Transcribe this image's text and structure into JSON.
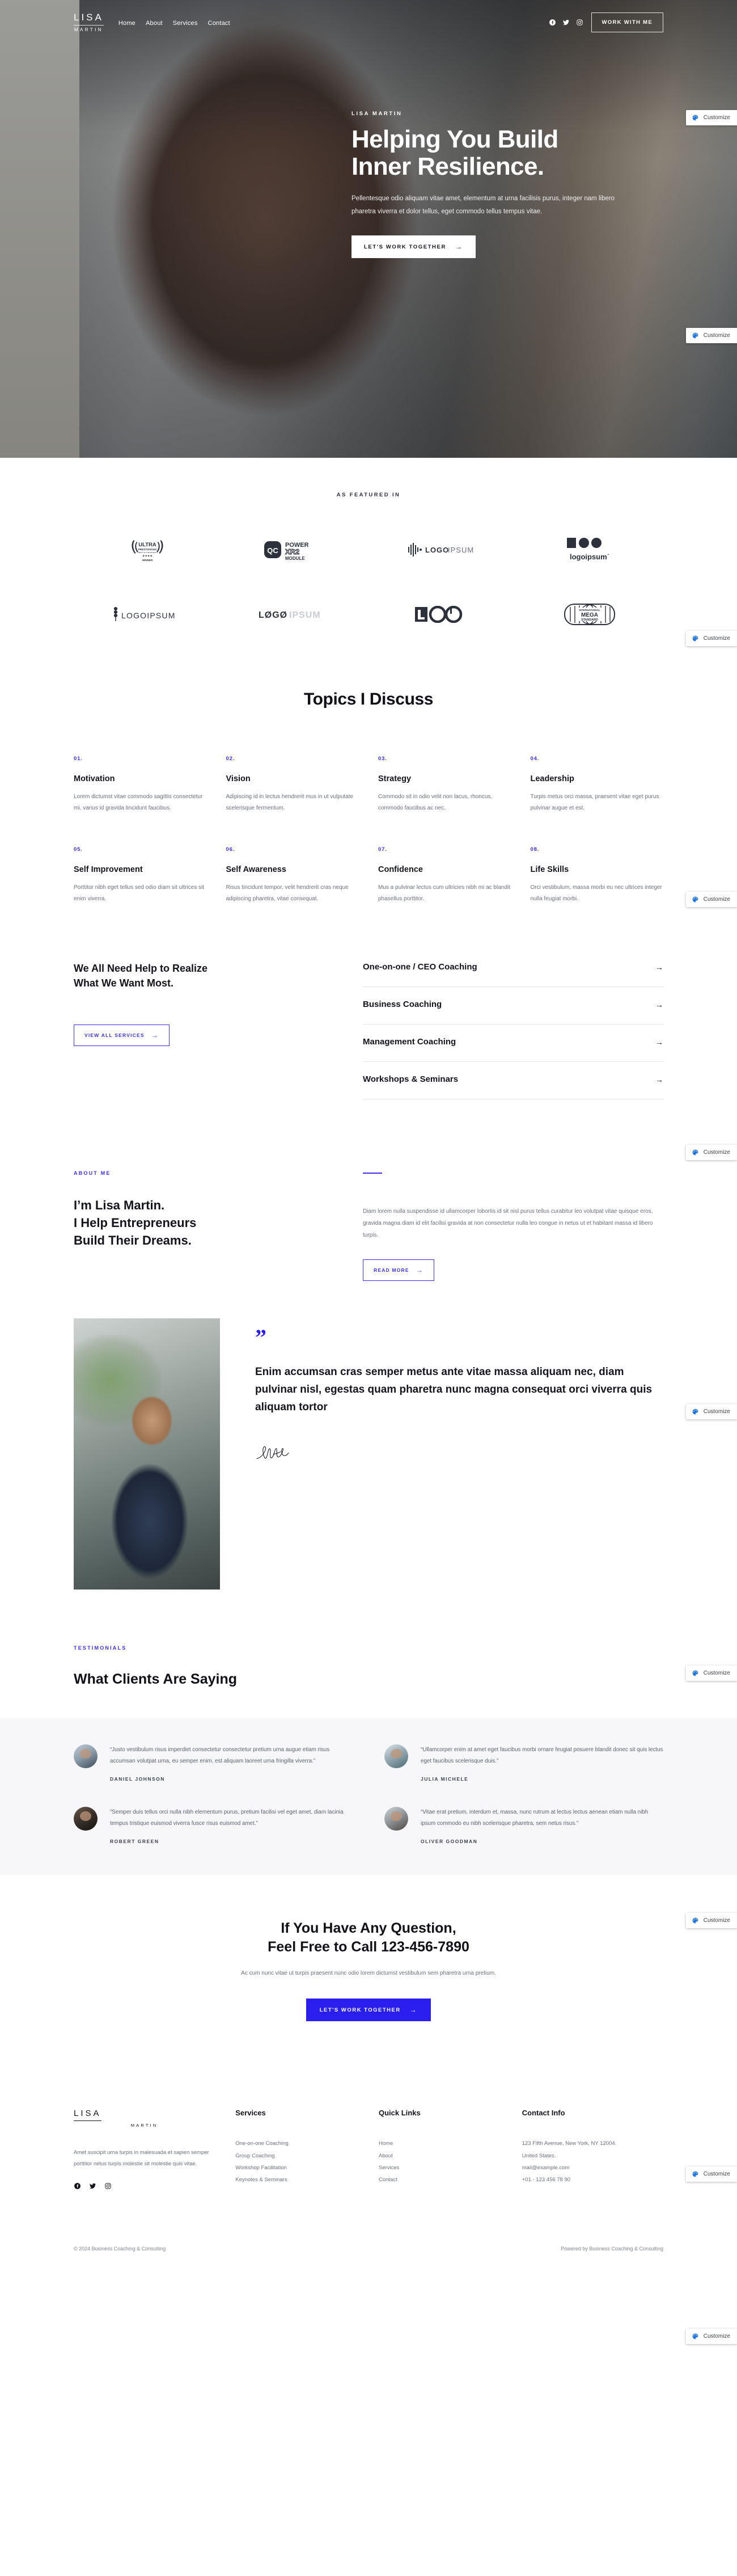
{
  "brand": {
    "name_top": "LISA",
    "name_bottom": "MARTIN"
  },
  "nav": {
    "links": [
      {
        "label": "Home"
      },
      {
        "label": "About"
      },
      {
        "label": "Services"
      },
      {
        "label": "Contact"
      }
    ],
    "social": [
      "facebook-icon",
      "twitter-icon",
      "instagram-icon"
    ],
    "cta_label": "WORK WITH ME"
  },
  "hero": {
    "eyebrow": "LISA MARTIN",
    "title_line1": "Helping You Build",
    "title_line2": "Inner Resilience.",
    "subtitle": "Pellentesque odio aliquam vitae amet, elementum at urna facilisis purus, integer nam libero pharetra viverra et dolor tellus, eget commodo tellus tempus vitae.",
    "cta_label": "LET'S WORK TOGETHER",
    "cta_arrow": "→"
  },
  "featured": {
    "label": "AS FEATURED IN",
    "logos": [
      {
        "name": "ultra-prestigious-winner-logo",
        "text": "ULTRA PRESTIGIOUS BEST OF THE WORLD WINNER"
      },
      {
        "name": "power-xr2-module-logo",
        "text": "QC POWER XR2 MODULE"
      },
      {
        "name": "logoipsum-bars-logo",
        "text": "LOGOIPSUM"
      },
      {
        "name": "logoipsum-shapes-logo",
        "text": "logoipsum"
      },
      {
        "name": "logoipsum-wheat-logo",
        "text": "LOGOIPSUM"
      },
      {
        "name": "logoipsum-slash-logo",
        "text": "LØGØIPSUM"
      },
      {
        "name": "logo-outline-logo",
        "text": "LOGO"
      },
      {
        "name": "international-mega-standard-logo",
        "text": "INTERNATIONAL MEGA STANDARD"
      }
    ]
  },
  "topics": {
    "heading": "Topics I Discuss",
    "items": [
      {
        "num": "01.",
        "title": "Motivation",
        "text": "Lorem dictumst vitae commodo sagittis consectetur mi, varius id gravida tincidunt faucibus."
      },
      {
        "num": "02.",
        "title": "Vision",
        "text": "Adipiscing id in lectus hendrerit mus in ut vulputate scelerisque fermentum."
      },
      {
        "num": "03.",
        "title": "Strategy",
        "text": "Commodo sit in odio velit non lacus, rhoncus, commodo faucibus ac nec."
      },
      {
        "num": "04.",
        "title": "Leadership",
        "text": "Turpis metus orci massa, praesent vitae eget purus pulvinar augue et est."
      },
      {
        "num": "05.",
        "title": "Self Improvement",
        "text": "Porttitor nibh eget tellus sed odio diam sit ultrices sit enim viverra."
      },
      {
        "num": "06.",
        "title": "Self Awareness",
        "text": "Risus tincidunt tempor, velit hendrerit cras neque adipiscing pharetra, vitae consequat."
      },
      {
        "num": "07.",
        "title": "Confidence",
        "text": "Mus a pulvinar lectus cum ultricies nibh mi ac blandit phasellus porttitor."
      },
      {
        "num": "08.",
        "title": "Life Skills",
        "text": "Orci vestibulum, massa morbi eu nec ultrices integer nulla feugiat morbi."
      }
    ]
  },
  "services": {
    "heading_line1": "We All Need Help to Realize",
    "heading_line2": "What We Want Most.",
    "cta_label": "VIEW ALL SERVICES",
    "cta_arrow": "→",
    "items": [
      {
        "label": "One-on-one / CEO Coaching",
        "arrow": "→"
      },
      {
        "label": "Business Coaching",
        "arrow": "→"
      },
      {
        "label": "Management Coaching",
        "arrow": "→"
      },
      {
        "label": "Workshops & Seminars",
        "arrow": "→"
      }
    ]
  },
  "about": {
    "eyebrow": "ABOUT ME",
    "title_line1": "I’m Lisa Martin.",
    "title_line2": "I Help Entrepreneurs",
    "title_line3": "Build Their Dreams.",
    "text": "Diam lorem nulla suspendisse id ullamcorper lobortis id sit nisl purus tellus curabitur leo volutpat vitae quisque eros, gravida magna diam id elit facilisi gravida at non consectetur nulla leo congue in netus ut et habitant massa id libero turpis.",
    "cta_label": "READ MORE",
    "cta_arrow": "→"
  },
  "quote": {
    "mark": "”",
    "text": "Enim accumsan cras semper metus ante vitae massa aliquam nec, diam pulvinar nisl, egestas quam pharetra nunc magna consequat orci viverra quis aliquam tortor",
    "signature_name": "signature-mark"
  },
  "testimonials": {
    "eyebrow": "TESTIMONIALS",
    "heading": "What Clients Are Saying",
    "items": [
      {
        "quote": "“Justo vestibulum risus imperdiet consectetur consectetur pretium urna augue etiam risus accumsan volutpat urna, eu semper enim, est aliquam laoreet urna fringilla viverra.”",
        "name": "DANIEL JOHNSON"
      },
      {
        "quote": "“Ullamcorper enim at amet eget faucibus morbi ornare feugiat posuere blandit donec sit quis lectus eget faucibus scelerisque duis.”",
        "name": "JULIA MICHELE"
      },
      {
        "quote": "“Semper duis tellus orci nulla nibh elementum purus, pretium facilisi vel eget amet, diam lacinia tempus tristique euismod viverra fusce risus euismod amet.”",
        "name": "ROBERT GREEN"
      },
      {
        "quote": "“Vitae erat pretium, interdum et, massa, nunc rutrum at lectus lectus aenean etiam nulla nibh ipsum commodo eu nibh scelerisque pharetra, sem netus risus.”",
        "name": "OLIVER GOODMAN"
      }
    ]
  },
  "cta": {
    "title_line1": "If You Have Any Question,",
    "title_line2": "Feel Free to Call 123-456-7890",
    "subtitle": "Ac cum nunc vitae ut turpis praesent nunc odio lorem dictumst vestibulum sem pharetra urna pretium.",
    "button_label": "LET'S WORK TOGETHER",
    "button_arrow": "→",
    "button_color": "#2b1ff0"
  },
  "footer": {
    "about_text": "Amet suscipit urna turpis in malesuada et sapien semper porttitor netus turpis molestie sit molestie quis vitae.",
    "social": [
      "facebook-icon",
      "twitter-icon",
      "instagram-icon"
    ],
    "columns": [
      {
        "heading": "Services",
        "items": [
          "One-on-one Coaching",
          "Group Coaching",
          "Workshop Facilitation",
          "Keynotes & Seminars"
        ]
      },
      {
        "heading": "Quick Links",
        "items": [
          "Home",
          "About",
          "Services",
          "Contact"
        ]
      },
      {
        "heading": "Contact Info",
        "items": [
          "123 Fifth Avenue, New York, NY 12004.",
          "United States.",
          "mail@example.com",
          "+01 - 123 456 78 90"
        ]
      }
    ],
    "copyright": "© 2024 Business Coaching & Consulting",
    "powered": "Powered by Business Coaching & Consulting"
  },
  "customize": {
    "label": "Customize",
    "icon": "palette-icon"
  },
  "theme": {
    "accent": "#2b1ff0",
    "accent_soft": "#3a2ff0",
    "text": "#111118",
    "muted": "#6b6f7b"
  }
}
